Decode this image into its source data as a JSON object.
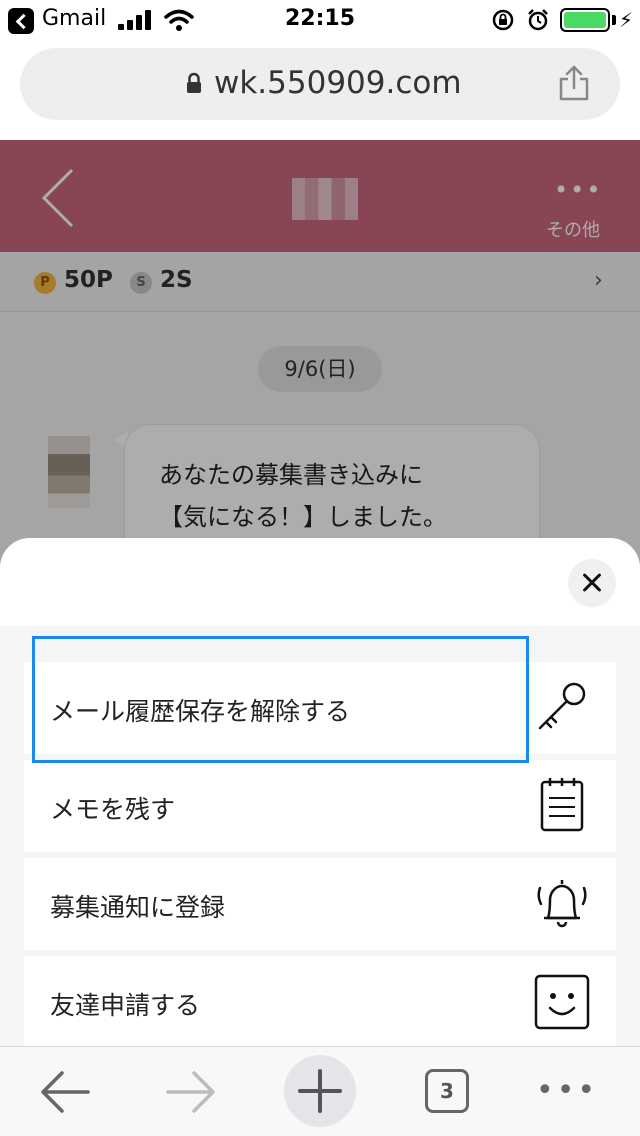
{
  "status_bar": {
    "back_app": "Gmail",
    "time": "22:15",
    "battery_color": "#4cd964"
  },
  "browser": {
    "url": "wk.550909.com",
    "icons": [
      "lock-icon",
      "share-icon"
    ]
  },
  "app_header": {
    "more_label": "その他",
    "accent_color": "#c9687d"
  },
  "points_bar": {
    "p_badge": "P",
    "p_value": "50P",
    "s_badge": "S",
    "s_value": "2S",
    "chevron": "›"
  },
  "chat": {
    "date": "9/6(日)",
    "message_line1": "あなたの募集書き込みに",
    "message_line2": "【気になる！】しました。"
  },
  "sheet": {
    "items": [
      {
        "label": "メール履歴保存を解除する",
        "icon": "key-icon"
      },
      {
        "label": "メモを残す",
        "icon": "memo-icon"
      },
      {
        "label": "募集通知に登録",
        "icon": "bell-icon"
      },
      {
        "label": "友達申請する",
        "icon": "smiley-icon"
      }
    ],
    "focus_color": "#1a8af0"
  },
  "toolbar": {
    "tab_count": "3",
    "icons": [
      "back-arrow-icon",
      "forward-arrow-icon",
      "plus-icon",
      "tabs-icon",
      "more-icon"
    ]
  }
}
